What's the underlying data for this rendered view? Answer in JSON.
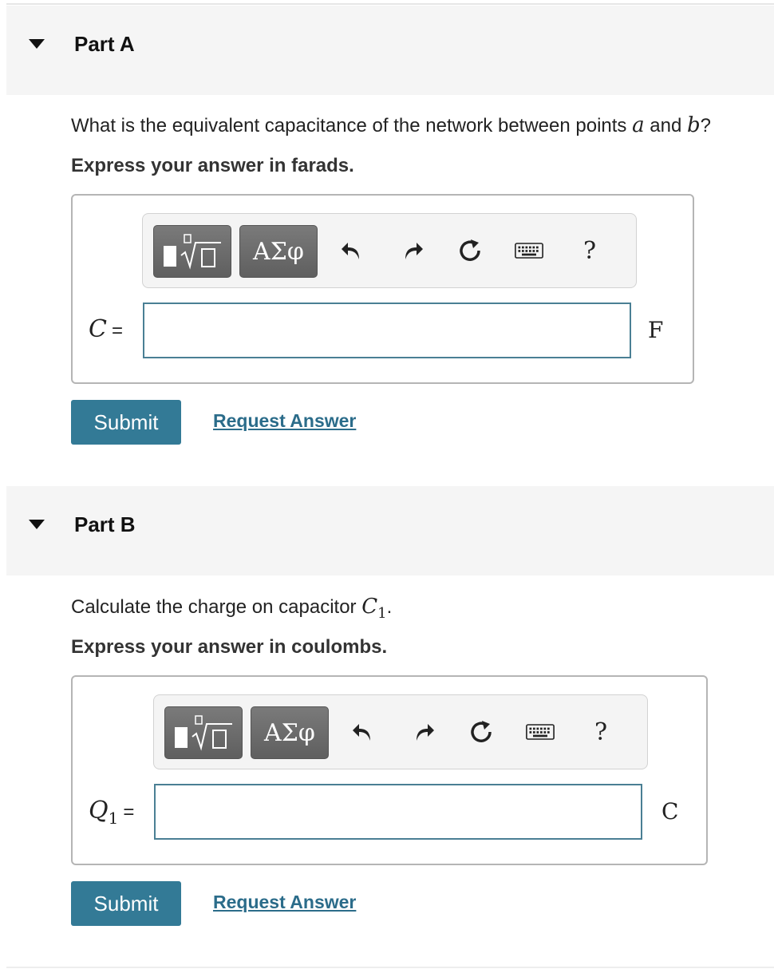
{
  "partA": {
    "title": "Part A",
    "question_prefix": "What is the equivalent capacitance of the network between points ",
    "var_a": "a",
    "and": " and ",
    "var_b": "b",
    "question_suffix": "?",
    "instruction": "Express your answer in farads.",
    "toolbar": {
      "greek_label": "ΑΣφ",
      "help_label": "?"
    },
    "variable": "C",
    "equals": "=",
    "input_value": "",
    "unit": "F",
    "submit_label": "Submit",
    "request_label": "Request Answer"
  },
  "partB": {
    "title": "Part B",
    "question_prefix": "Calculate the charge on capacitor ",
    "var_c": "C",
    "var_c_sub": "1",
    "question_suffix": ".",
    "instruction": "Express your answer in coulombs.",
    "toolbar": {
      "greek_label": "ΑΣφ",
      "help_label": "?"
    },
    "variable": "Q",
    "variable_sub": "1",
    "equals": "=",
    "input_value": "",
    "unit": "C",
    "submit_label": "Submit",
    "request_label": "Request Answer"
  },
  "icons": [
    "caret-down-icon",
    "templates-icon",
    "undo-icon",
    "redo-icon",
    "reset-icon",
    "keyboard-icon",
    "help-icon"
  ]
}
